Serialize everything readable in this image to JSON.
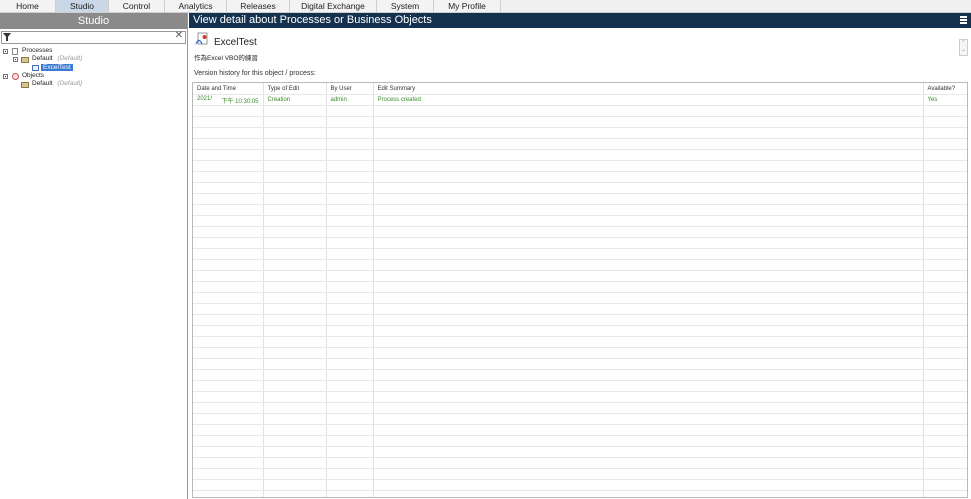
{
  "nav": {
    "tabs": [
      "Home",
      "Studio",
      "Control",
      "Analytics",
      "Releases",
      "Digital Exchange",
      "System",
      "My Profile"
    ],
    "active": "Studio"
  },
  "left": {
    "title": "Studio",
    "filter_value": "",
    "tree": {
      "processes": "Processes",
      "processes_group": "Default",
      "processes_group_tag": "(Default)",
      "selected_item": "ExcelTest",
      "objects": "Objects",
      "objects_group": "Default",
      "objects_group_tag": "(Default)"
    }
  },
  "right": {
    "title": "View detail about Processes or Business Objects",
    "object_name": "ExcelTest",
    "object_description": "作為Excel VBO的練習",
    "history_label": "Version history for this object / process:",
    "columns": [
      "Date and Time",
      "Type of Edit",
      "By User",
      "Edit Summary",
      "Available?"
    ],
    "rows": [
      {
        "date": "2021/",
        "time": "下午 10:30:05",
        "type": "Creation",
        "user": "admin",
        "summary": "Process created",
        "available": "Yes"
      }
    ]
  },
  "colors": {
    "header_bg": "#14324f",
    "left_header_bg": "#8a8a8a",
    "row_text": "#3c8a2e",
    "selection": "#3a7bd5"
  },
  "icons": [
    "filter-icon",
    "clear-icon",
    "menu-icon",
    "excel-process-icon"
  ]
}
